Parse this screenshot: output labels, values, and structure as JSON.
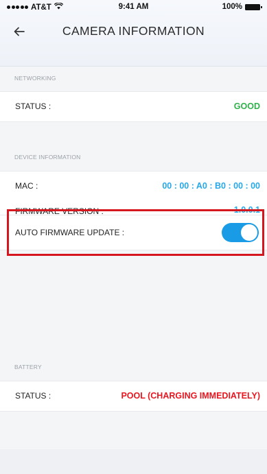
{
  "status_bar": {
    "carrier": "AT&T",
    "time": "9:41 AM",
    "battery": "100%"
  },
  "header": {
    "title": "CAMERA INFORMATION"
  },
  "sections": {
    "networking": {
      "title": "NETWORKING",
      "status_label": "STATUS :",
      "status_value": "GOOD"
    },
    "device": {
      "title": "DEVICE INFORMATION",
      "mac_label": "MAC :",
      "mac_value": "00 : 00 : A0 : B0 : 00 : 00",
      "firmware_label": "FIRMWARE VERSION :",
      "firmware_value": "1.0.0.1",
      "auto_update_label": "AUTO FIRMWARE UPDATE :",
      "auto_update_on": true
    },
    "battery": {
      "title": "BATTERY",
      "status_label": "STATUS :",
      "status_value": "POOL (CHARGING IMMEDIATELY)"
    }
  },
  "colors": {
    "good": "#2fb24c",
    "info": "#27a8e8",
    "alert": "#e8161f",
    "toggle_on": "#1a9be6",
    "highlight": "#d6161e"
  },
  "icons": {
    "back": "arrow-left-icon",
    "wifi": "wifi-icon",
    "battery": "battery-icon"
  }
}
